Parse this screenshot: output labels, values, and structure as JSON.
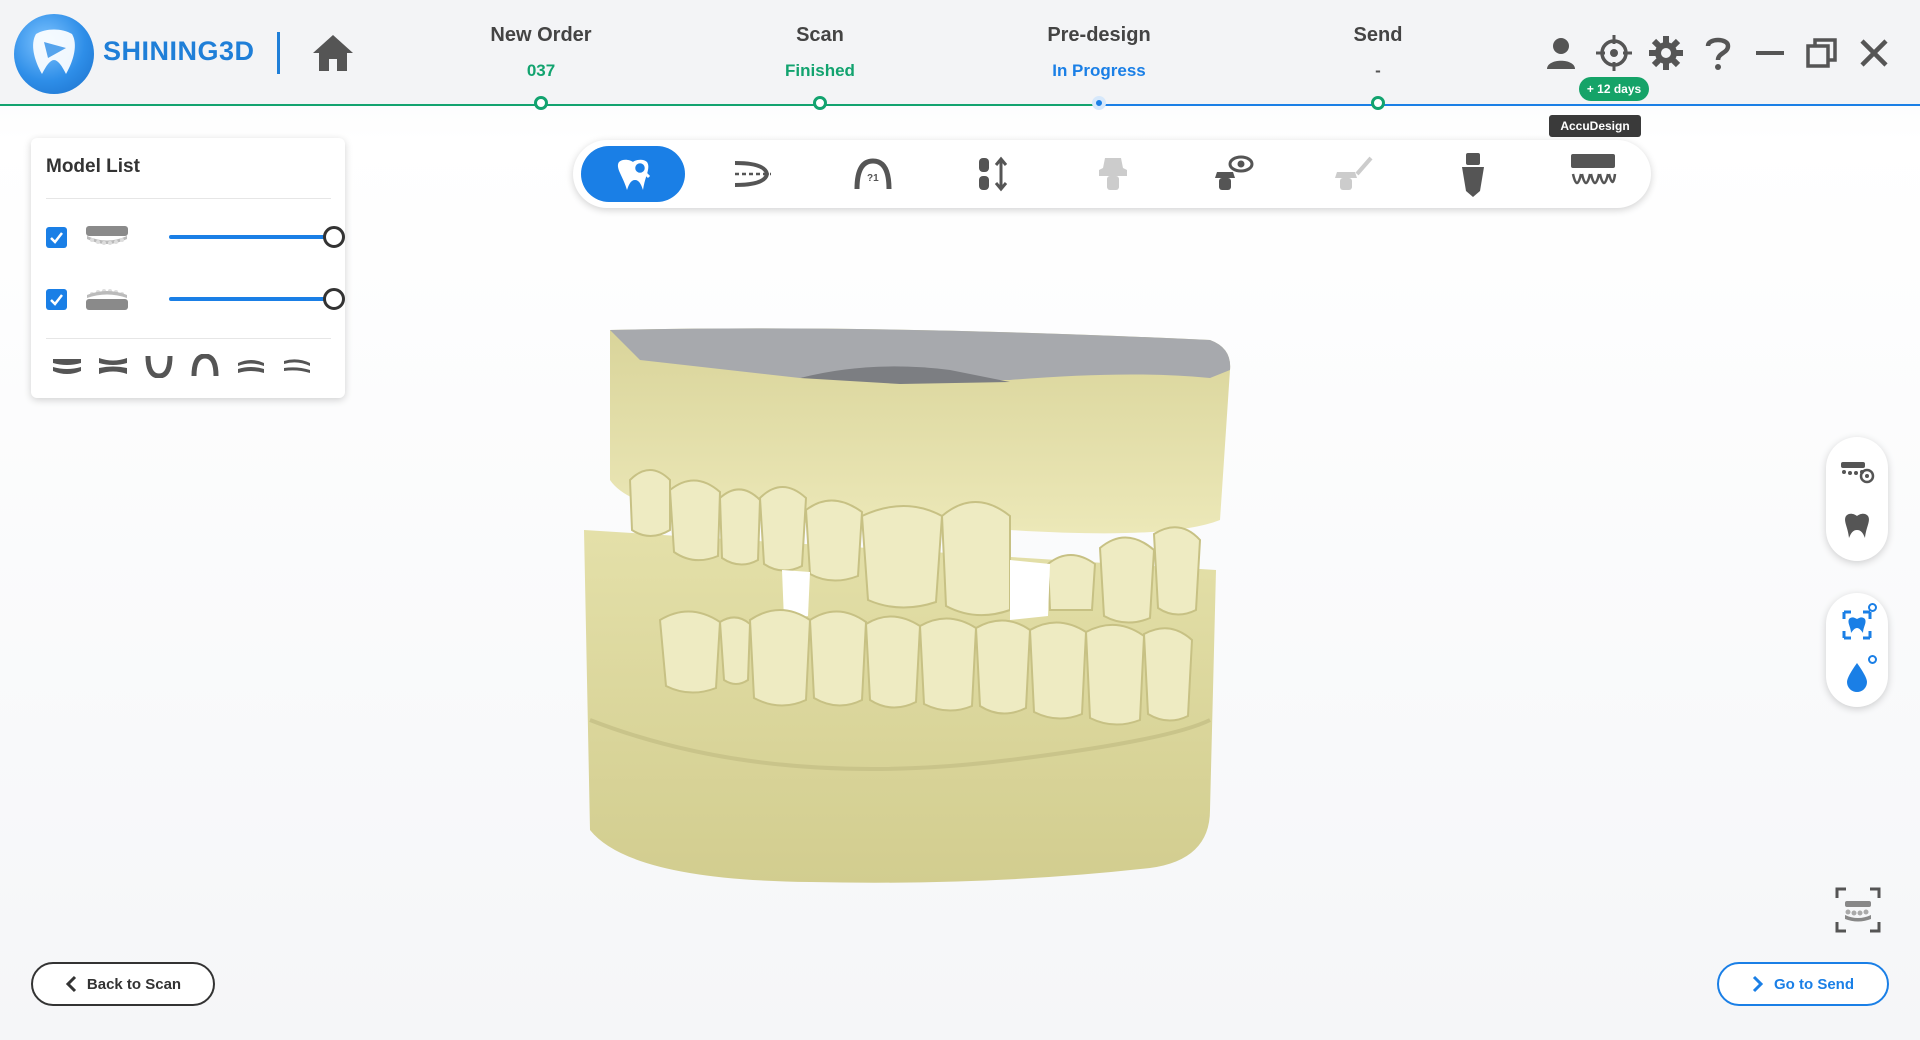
{
  "app": {
    "brand": "SHINING3D"
  },
  "steps": [
    {
      "label": "New Order",
      "status": "037",
      "status_color": "#12a36f",
      "state": "done"
    },
    {
      "label": "Scan",
      "status": "Finished",
      "status_color": "#12a36f",
      "state": "done"
    },
    {
      "label": "Pre-design",
      "status": "In Progress",
      "status_color": "#1a7fe6",
      "state": "current"
    },
    {
      "label": "Send",
      "status": "-",
      "status_color": "#555555",
      "state": "pending"
    }
  ],
  "header": {
    "trial_badge": "+ 12 days",
    "tooltip": "AccuDesign",
    "icons": [
      "user-icon",
      "crosshair-icon",
      "gear-icon",
      "help-icon",
      "minimize-icon",
      "restore-icon",
      "close-icon"
    ]
  },
  "model_list": {
    "title": "Model List",
    "models": [
      {
        "name": "upper-jaw",
        "checked": true,
        "opacity": 1.0
      },
      {
        "name": "lower-jaw",
        "checked": true,
        "opacity": 1.0
      }
    ],
    "view_buttons": [
      "upper-view-icon",
      "both-view-icon",
      "lower-arch-icon",
      "upper-arch-icon",
      "left-view-icon",
      "right-view-icon"
    ]
  },
  "toolbar": {
    "tools": [
      "tooth-analysis-icon",
      "trim-icon",
      "margin-line-icon",
      "occlusion-icon",
      "abutment-icon",
      "view-check-icon",
      "sculpt-icon",
      "implant-icon",
      "accudesign-icon"
    ],
    "active_index": 0
  },
  "actions": {
    "back": "Back to Scan",
    "next": "Go to Send"
  },
  "colors": {
    "accent": "#1a7fe6",
    "success": "#12a36f",
    "model": "#e8e4ae"
  }
}
